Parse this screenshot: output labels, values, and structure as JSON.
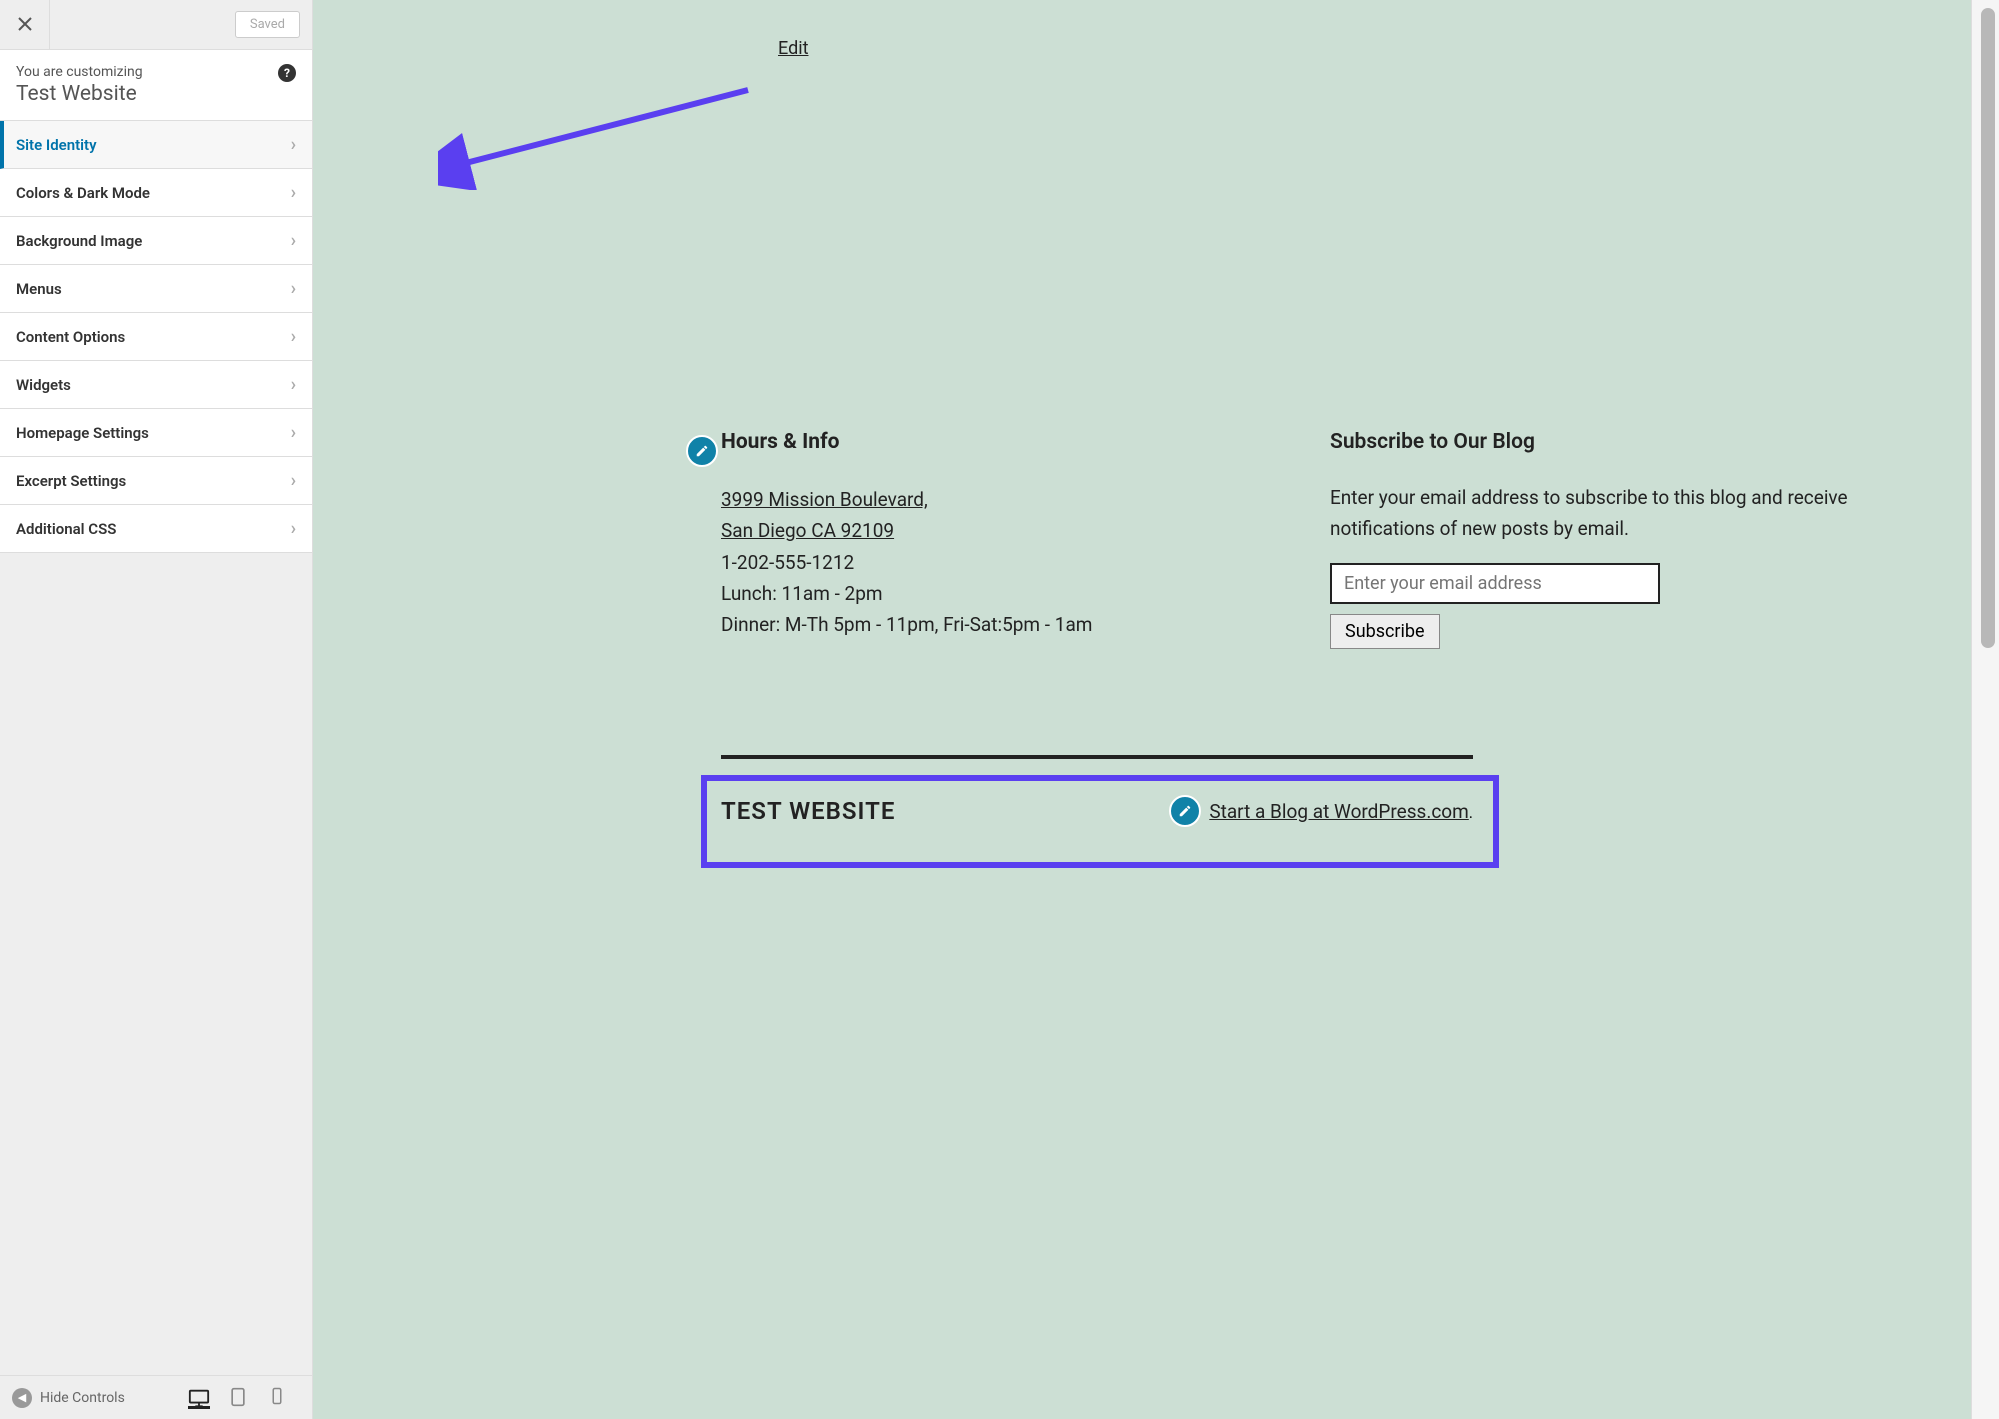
{
  "sidebar": {
    "saved_label": "Saved",
    "customizing_label": "You are customizing",
    "site_name": "Test Website",
    "items": [
      {
        "label": "Site Identity",
        "active": true
      },
      {
        "label": "Colors & Dark Mode"
      },
      {
        "label": "Background Image"
      },
      {
        "label": "Menus"
      },
      {
        "label": "Content Options"
      },
      {
        "label": "Widgets"
      },
      {
        "label": "Homepage Settings"
      },
      {
        "label": "Excerpt Settings"
      },
      {
        "label": "Additional CSS"
      }
    ],
    "hide_controls_label": "Hide Controls"
  },
  "preview": {
    "edit_link": "Edit",
    "widgets": {
      "hours": {
        "title": "Hours & Info",
        "address_line1": "3999 Mission Boulevard,",
        "address_line2": "San Diego CA 92109",
        "phone": "1-202-555-1212",
        "lunch": "Lunch: 11am - 2pm",
        "dinner": "Dinner: M-Th 5pm - 11pm, Fri-Sat:5pm - 1am"
      },
      "subscribe": {
        "title": "Subscribe to Our Blog",
        "description": "Enter your email address to subscribe to this blog and receive notifications of new posts by email.",
        "placeholder": "Enter your email address",
        "button_label": "Subscribe"
      }
    },
    "footer": {
      "site_title": "TEST WEBSITE",
      "wp_link": "Start a Blog at WordPress.com",
      "wp_link_suffix": "."
    }
  }
}
